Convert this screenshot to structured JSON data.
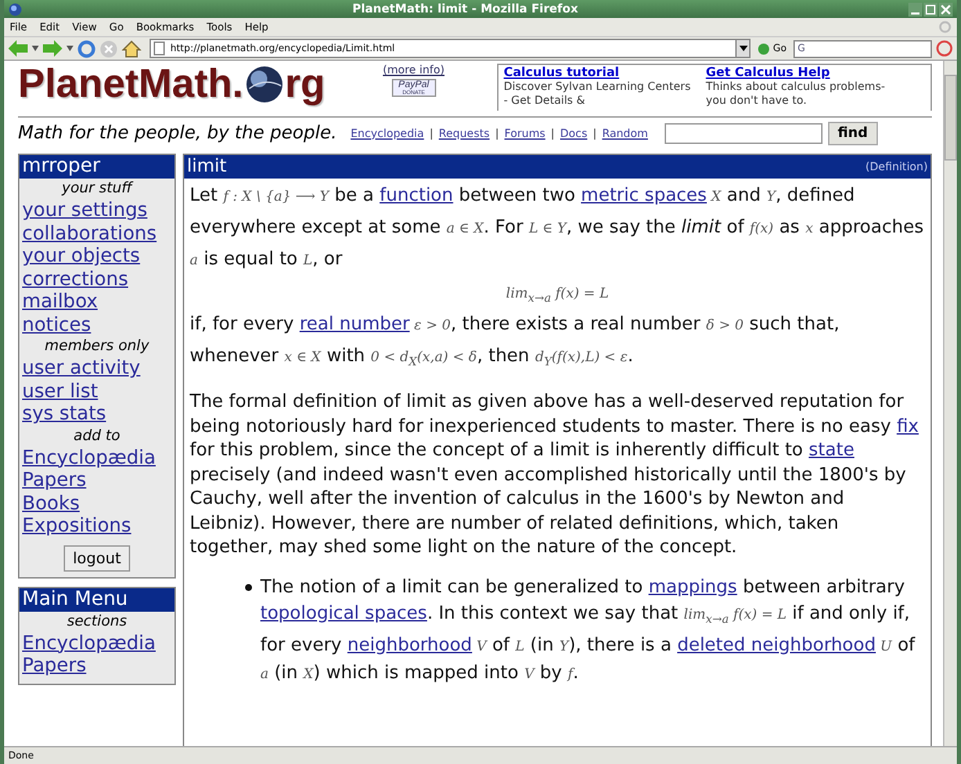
{
  "window": {
    "title": "PlanetMath: limit - Mozilla Firefox"
  },
  "menu": [
    "File",
    "Edit",
    "View",
    "Go",
    "Bookmarks",
    "Tools",
    "Help"
  ],
  "toolbar": {
    "url": "http://planetmath.org/encyclopedia/Limit.html",
    "go": "Go",
    "search_value": "G"
  },
  "header": {
    "logo_left": "PlanetMath.",
    "logo_right": "rg",
    "more_info": "(more info)",
    "paypal": "PayPal",
    "donate": "DONATE",
    "ads": [
      {
        "title": "Calculus tutorial",
        "text": "Discover Sylvan Learning Centers - Get Details &"
      },
      {
        "title": "Get Calculus Help",
        "text": "Thinks about calculus problems-you don't have to."
      }
    ],
    "tagline": "Math for the people, by the people.",
    "nav": [
      "Encyclopedia",
      "Requests",
      "Forums",
      "Docs",
      "Random"
    ],
    "nav_separator": "|",
    "find": "find"
  },
  "sidebar": [
    {
      "title": "mrroper",
      "items": [
        {
          "kind": "heading",
          "text": "your stuff"
        },
        {
          "kind": "link",
          "text": "your settings"
        },
        {
          "kind": "link",
          "text": "collaborations"
        },
        {
          "kind": "link",
          "text": "your objects"
        },
        {
          "kind": "link",
          "text": "corrections"
        },
        {
          "kind": "link",
          "text": "mailbox"
        },
        {
          "kind": "link",
          "text": "notices"
        },
        {
          "kind": "heading",
          "text": "members only"
        },
        {
          "kind": "link",
          "text": "user activity"
        },
        {
          "kind": "link",
          "text": "user list"
        },
        {
          "kind": "link",
          "text": "sys stats"
        },
        {
          "kind": "heading",
          "text": "add to"
        },
        {
          "kind": "link",
          "text": "Encyclopædia"
        },
        {
          "kind": "link",
          "text": "Papers"
        },
        {
          "kind": "link",
          "text": "Books"
        },
        {
          "kind": "link",
          "text": "Expositions"
        },
        {
          "kind": "button",
          "text": "logout"
        }
      ]
    },
    {
      "title": "Main Menu",
      "items": [
        {
          "kind": "heading",
          "text": "sections"
        },
        {
          "kind": "link",
          "text": "Encyclopædia"
        },
        {
          "kind": "link",
          "text": "Papers"
        }
      ]
    }
  ],
  "entry": {
    "title": "limit",
    "type": "(Definition)",
    "paragraphs": [
      {
        "kind": "math",
        "parts": [
          {
            "kind": "text",
            "text": "Let "
          },
          {
            "kind": "math",
            "text": "f : X \\ {a} ⟶ Y"
          },
          {
            "kind": "text",
            "text": " be a "
          },
          {
            "kind": "link",
            "text": "function"
          },
          {
            "kind": "text",
            "text": " between two "
          },
          {
            "kind": "link",
            "text": "metric spaces"
          },
          {
            "kind": "math",
            "text": " X"
          },
          {
            "kind": "text",
            "text": " and "
          },
          {
            "kind": "math",
            "text": "Y"
          },
          {
            "kind": "text",
            "text": ", defined everywhere except at some "
          },
          {
            "kind": "math",
            "text": "a ∈ X"
          },
          {
            "kind": "text",
            "text": ". For "
          },
          {
            "kind": "math",
            "text": "L ∈ Y"
          },
          {
            "kind": "text",
            "text": ", we say the *limit* of "
          },
          {
            "kind": "math",
            "text": "f(x)"
          },
          {
            "kind": "text",
            "text": " as "
          },
          {
            "kind": "math",
            "text": "x"
          },
          {
            "kind": "text",
            "text": " approaches "
          },
          {
            "kind": "math",
            "text": "a"
          },
          {
            "kind": "text",
            "text": " is equal to "
          },
          {
            "kind": "math",
            "text": "L"
          },
          {
            "kind": "text",
            "text": ", or"
          }
        ]
      },
      {
        "kind": "display",
        "parts": [
          {
            "kind": "math",
            "text": "lim$_{x→a}$ f(x) = L"
          }
        ]
      },
      {
        "kind": "math",
        "parts": [
          {
            "kind": "text",
            "text": "if, for every "
          },
          {
            "kind": "link",
            "text": "real number"
          },
          {
            "kind": "math",
            "text": " ε > 0"
          },
          {
            "kind": "text",
            "text": ", there exists a real number "
          },
          {
            "kind": "math",
            "text": "δ > 0"
          },
          {
            "kind": "text",
            "text": " such that, whenever "
          },
          {
            "kind": "math",
            "text": "x ∈ X"
          },
          {
            "kind": "text",
            "text": " with "
          },
          {
            "kind": "math",
            "text": "0 < d$_{X}$(x,a) < δ"
          },
          {
            "kind": "text",
            "text": ", then "
          },
          {
            "kind": "math",
            "text": "d$_{Y}$(f(x),L) < ε"
          },
          {
            "kind": "text",
            "text": "."
          }
        ]
      },
      {
        "kind": "plain",
        "parts": [
          {
            "kind": "text",
            "text": "The formal definition of limit as given above has a well-deserved reputation for being notoriously hard for inexperienced students to master. There is no easy "
          },
          {
            "kind": "link",
            "text": "fix"
          },
          {
            "kind": "text",
            "text": " for this problem, since the concept of a limit is inherently difficult to "
          },
          {
            "kind": "link",
            "text": "state"
          },
          {
            "kind": "text",
            "text": " precisely (and indeed wasn't even accomplished historically until the 1800's by Cauchy, well after the invention of calculus in the 1600's by Newton and Leibniz). However, there are number of related definitions, which, taken together, may shed some light on the nature of the concept."
          }
        ]
      },
      {
        "kind": "bullet",
        "parts": [
          {
            "kind": "text",
            "text": "The notion of a limit can be generalized to "
          },
          {
            "kind": "link",
            "text": "mappings"
          },
          {
            "kind": "text",
            "text": " between arbitrary "
          },
          {
            "kind": "link",
            "text": "topological spaces"
          },
          {
            "kind": "text",
            "text": ". In this context we say that "
          },
          {
            "kind": "math",
            "text": "lim$_{x→a}$ f(x) = L"
          },
          {
            "kind": "text",
            "text": " if and only if, for every "
          },
          {
            "kind": "link",
            "text": "neighborhood"
          },
          {
            "kind": "math",
            "text": " V"
          },
          {
            "kind": "text",
            "text": " of "
          },
          {
            "kind": "math",
            "text": "L"
          },
          {
            "kind": "text",
            "text": " (in "
          },
          {
            "kind": "math",
            "text": "Y"
          },
          {
            "kind": "text",
            "text": "), there is a "
          },
          {
            "kind": "link",
            "text": "deleted neighborhood"
          },
          {
            "kind": "math",
            "text": " U"
          },
          {
            "kind": "text",
            "text": " of "
          },
          {
            "kind": "math",
            "text": "a"
          },
          {
            "kind": "text",
            "text": " (in "
          },
          {
            "kind": "math",
            "text": "X"
          },
          {
            "kind": "text",
            "text": ") which is mapped into "
          },
          {
            "kind": "math",
            "text": "V"
          },
          {
            "kind": "text",
            "text": " by "
          },
          {
            "kind": "math",
            "text": "f"
          },
          {
            "kind": "text",
            "text": "."
          }
        ]
      }
    ]
  },
  "status_bar": "Done"
}
